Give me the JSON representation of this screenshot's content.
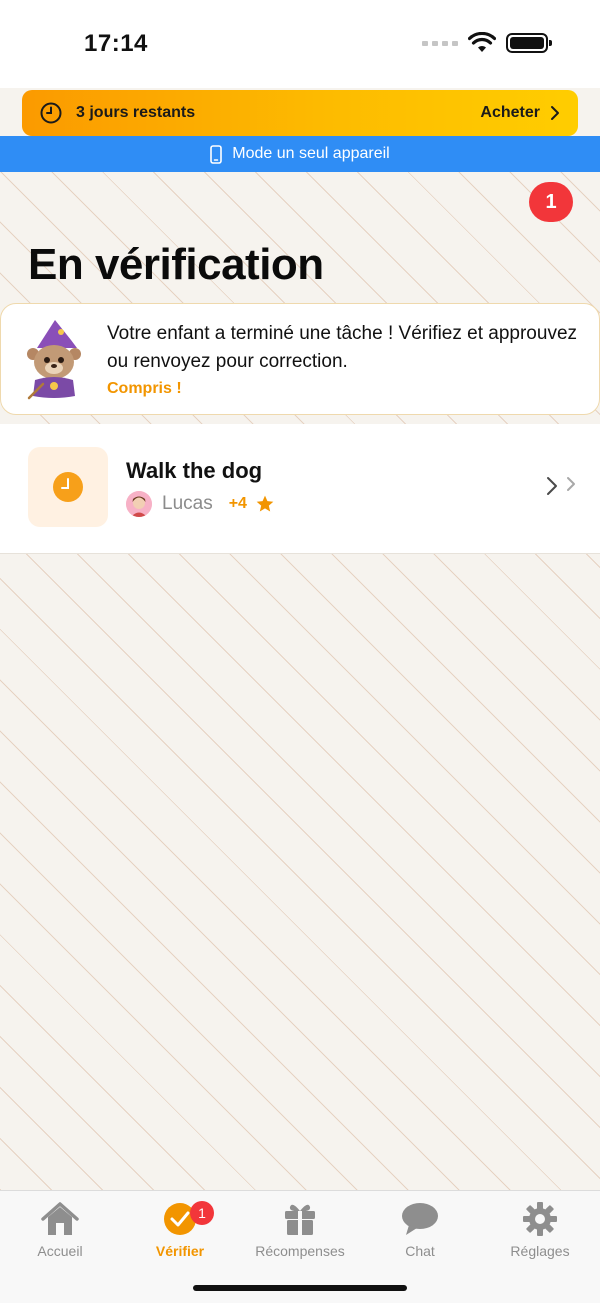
{
  "status_bar": {
    "time": "17:14"
  },
  "trial_banner": {
    "text": "3 jours restants",
    "action": "Acheter"
  },
  "mode_bar": {
    "label": "Mode un seul appareil"
  },
  "header": {
    "badge_count": "1",
    "title": "En vérification"
  },
  "info_card": {
    "message": "Votre enfant a terminé une tâche ! Vérifiez et approuvez ou renvoyez pour correction.",
    "link": "Compris !"
  },
  "tasks": [
    {
      "title": "Walk the dog",
      "child": "Lucas",
      "points": "+4"
    }
  ],
  "tab_bar": {
    "tabs": [
      {
        "label": "Accueil",
        "icon": "house-icon",
        "active": false
      },
      {
        "label": "Vérifier",
        "icon": "check-circle-icon",
        "active": true,
        "badge": "1"
      },
      {
        "label": "Récompenses",
        "icon": "gift-icon",
        "active": false
      },
      {
        "label": "Chat",
        "icon": "chat-bubble-icon",
        "active": false
      },
      {
        "label": "Réglages",
        "icon": "gear-icon",
        "active": false
      }
    ]
  },
  "colors": {
    "accent_orange": "#f29500",
    "banner_gradient_start": "#fb9a00",
    "banner_gradient_end": "#ffcd00",
    "mode_bar_blue": "#2f8df5",
    "badge_red": "#f2363a"
  }
}
